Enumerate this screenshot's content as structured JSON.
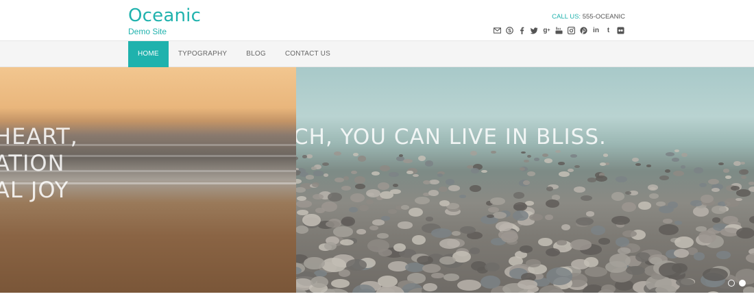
{
  "header": {
    "site_title": "Oceanic",
    "site_description": "Demo Site",
    "call_us_label": "CALL US:",
    "call_us_number": "555-OCEANIC"
  },
  "social_icons": [
    "email-icon",
    "skype-icon",
    "facebook-icon",
    "twitter-icon",
    "google-plus-icon",
    "youtube-icon",
    "instagram-icon",
    "pinterest-icon",
    "linkedin-icon",
    "tumblr-icon",
    "flickr-icon"
  ],
  "nav": {
    "items": [
      {
        "label": "HOME",
        "active": true
      },
      {
        "label": "TYPOGRAPHY",
        "active": false
      },
      {
        "label": "BLOG",
        "active": false
      },
      {
        "label": "CONTACT US",
        "active": false
      }
    ]
  },
  "slider": {
    "left_caption_lines": [
      "HEART,",
      "ATION",
      "AL JOY"
    ],
    "right_caption": "CH, YOU CAN LIVE IN BLISS.",
    "active_slide_index": 1,
    "slide_count": 2
  },
  "colors": {
    "accent": "#1fb2ad",
    "nav_background": "#f5f5f5",
    "text": "#555555"
  }
}
